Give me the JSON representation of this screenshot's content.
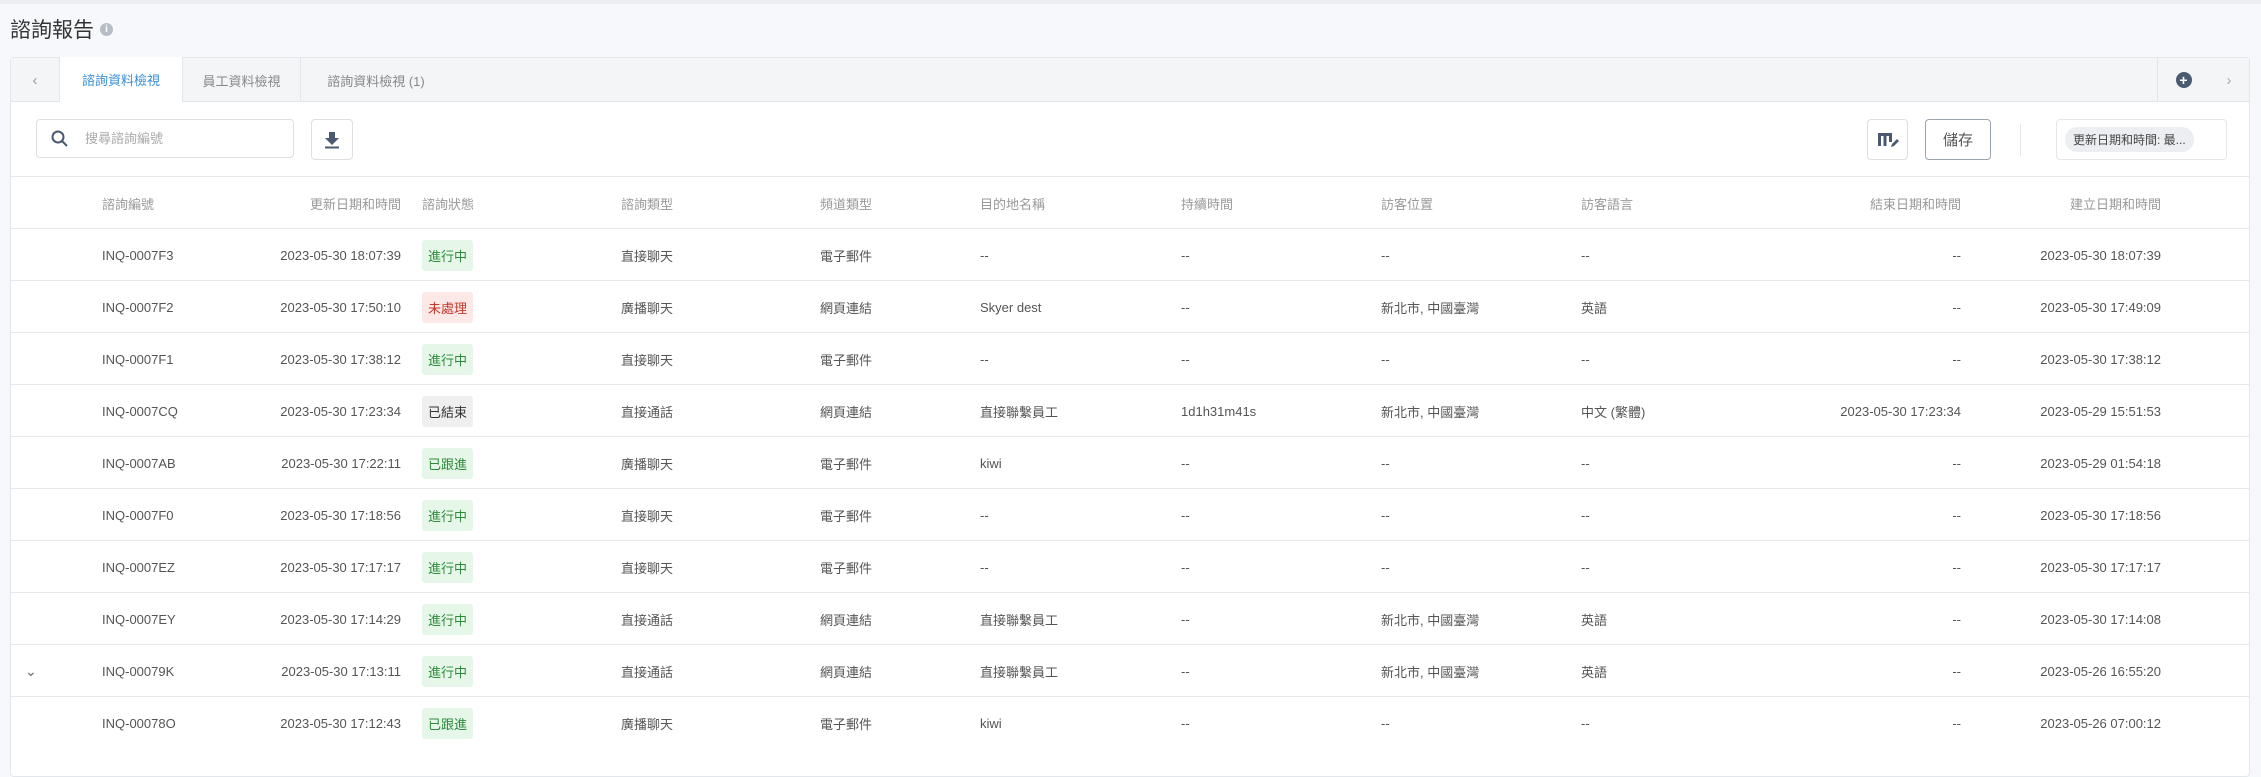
{
  "page": {
    "title": "諮詢報告"
  },
  "tabs": [
    {
      "label": "諮詢資料檢視",
      "active": true
    },
    {
      "label": "員工資料檢視"
    },
    {
      "label": "諮詢資料檢視 (1)"
    }
  ],
  "toolbar": {
    "search_placeholder": "搜尋諮詢編號",
    "save_label": "儲存",
    "sort_chip": "更新日期和時間: 最..."
  },
  "columns": [
    "諮詢編號",
    "更新日期和時間",
    "諮詢狀態",
    "諮詢類型",
    "頻道類型",
    "目的地名稱",
    "持續時間",
    "訪客位置",
    "訪客語言",
    "結束日期和時間",
    "建立日期和時間"
  ],
  "status_colors": {
    "green": "#2e8b3a",
    "red": "#c0392b",
    "gray": "#333333"
  },
  "rows": [
    {
      "id": "INQ-0007F3",
      "updated": "2023-05-30 18:07:39",
      "status": "進行中",
      "st": "green",
      "type": "直接聊天",
      "channel": "電子郵件",
      "dest": "--",
      "duration": "--",
      "location": "--",
      "lang": "--",
      "ended": "--",
      "created": "2023-05-30 18:07:39"
    },
    {
      "id": "INQ-0007F2",
      "updated": "2023-05-30 17:50:10",
      "status": "未處理",
      "st": "red",
      "type": "廣播聊天",
      "channel": "網頁連結",
      "dest": "Skyer dest",
      "duration": "--",
      "location": "新北市, 中國臺灣",
      "lang": "英語",
      "ended": "--",
      "created": "2023-05-30 17:49:09"
    },
    {
      "id": "INQ-0007F1",
      "updated": "2023-05-30 17:38:12",
      "status": "進行中",
      "st": "green",
      "type": "直接聊天",
      "channel": "電子郵件",
      "dest": "--",
      "duration": "--",
      "location": "--",
      "lang": "--",
      "ended": "--",
      "created": "2023-05-30 17:38:12"
    },
    {
      "id": "INQ-0007CQ",
      "updated": "2023-05-30 17:23:34",
      "status": "已結束",
      "st": "gray",
      "type": "直接通話",
      "channel": "網頁連結",
      "dest": "直接聯繫員工",
      "duration": "1d1h31m41s",
      "location": "新北市, 中國臺灣",
      "lang": "中文 (繁體)",
      "ended": "2023-05-30 17:23:34",
      "created": "2023-05-29 15:51:53"
    },
    {
      "id": "INQ-0007AB",
      "updated": "2023-05-30 17:22:11",
      "status": "已跟進",
      "st": "green",
      "type": "廣播聊天",
      "channel": "電子郵件",
      "dest": "kiwi",
      "duration": "--",
      "location": "--",
      "lang": "--",
      "ended": "--",
      "created": "2023-05-29 01:54:18"
    },
    {
      "id": "INQ-0007F0",
      "updated": "2023-05-30 17:18:56",
      "status": "進行中",
      "st": "green",
      "type": "直接聊天",
      "channel": "電子郵件",
      "dest": "--",
      "duration": "--",
      "location": "--",
      "lang": "--",
      "ended": "--",
      "created": "2023-05-30 17:18:56"
    },
    {
      "id": "INQ-0007EZ",
      "updated": "2023-05-30 17:17:17",
      "status": "進行中",
      "st": "green",
      "type": "直接聊天",
      "channel": "電子郵件",
      "dest": "--",
      "duration": "--",
      "location": "--",
      "lang": "--",
      "ended": "--",
      "created": "2023-05-30 17:17:17"
    },
    {
      "id": "INQ-0007EY",
      "updated": "2023-05-30 17:14:29",
      "status": "進行中",
      "st": "green",
      "type": "直接通話",
      "channel": "網頁連結",
      "dest": "直接聯繫員工",
      "duration": "--",
      "location": "新北市, 中國臺灣",
      "lang": "英語",
      "ended": "--",
      "created": "2023-05-30 17:14:08"
    },
    {
      "id": "INQ-00079K",
      "updated": "2023-05-30 17:13:11",
      "status": "進行中",
      "st": "green",
      "type": "直接通話",
      "channel": "網頁連結",
      "dest": "直接聯繫員工",
      "duration": "--",
      "location": "新北市, 中國臺灣",
      "lang": "英語",
      "ended": "--",
      "created": "2023-05-26 16:55:20",
      "expandable": true
    },
    {
      "id": "INQ-00078O",
      "updated": "2023-05-30 17:12:43",
      "status": "已跟進",
      "st": "green",
      "type": "廣播聊天",
      "channel": "電子郵件",
      "dest": "kiwi",
      "duration": "--",
      "location": "--",
      "lang": "--",
      "ended": "--",
      "created": "2023-05-26 07:00:12"
    }
  ]
}
